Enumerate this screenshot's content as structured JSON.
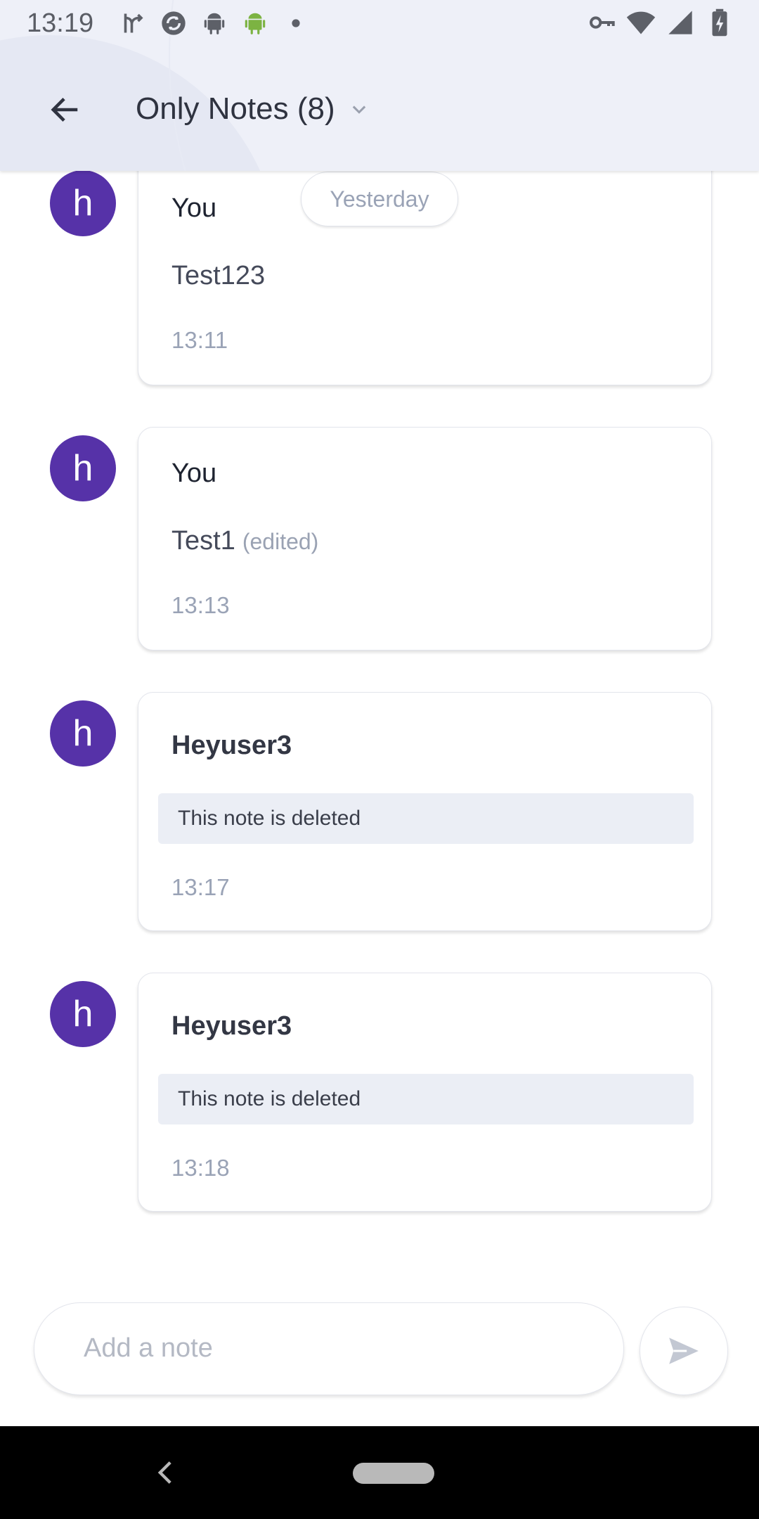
{
  "status_bar": {
    "time": "13:19",
    "left_icons": [
      "fork-icon",
      "sync-icon",
      "android-icon",
      "android-green-icon",
      "dot-icon"
    ],
    "right_icons": [
      "vpn-key-icon",
      "wifi-icon",
      "signal-icon",
      "battery-charging-icon"
    ]
  },
  "appbar": {
    "title": "Only Notes (8)",
    "back_icon": "arrow-left-icon",
    "dropdown_icon": "chevron-down-icon"
  },
  "date_separator": "Yesterday",
  "notes": [
    {
      "avatar_letter": "h",
      "author": "You",
      "text": "Test123",
      "edited": "",
      "deleted": "",
      "time": "13:11"
    },
    {
      "avatar_letter": "h",
      "author": "You",
      "text": "Test1",
      "edited": "(edited)",
      "deleted": "",
      "time": "13:13"
    },
    {
      "avatar_letter": "h",
      "author": "Heyuser3",
      "text": "",
      "edited": "",
      "deleted": "This note is deleted",
      "time": "13:17"
    },
    {
      "avatar_letter": "h",
      "author": "Heyuser3",
      "text": "",
      "edited": "",
      "deleted": "This note is deleted",
      "time": "13:18"
    }
  ],
  "composer": {
    "placeholder": "Add a note",
    "value": "",
    "send_icon": "send-icon"
  },
  "colors": {
    "avatar": "#5632a8",
    "header_bg": "#eef0f8",
    "deleted_bg": "#ebeef5"
  }
}
